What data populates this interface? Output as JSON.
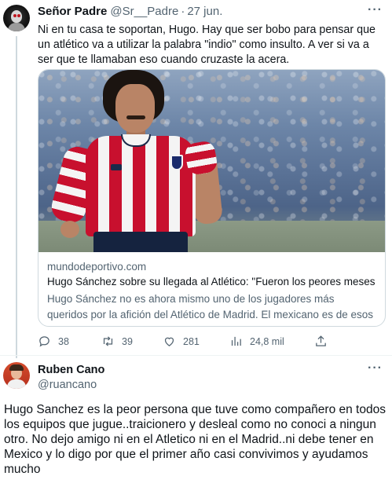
{
  "tweet1": {
    "display_name": "Señor Padre",
    "handle": "@Sr__Padre",
    "separator": "·",
    "date": "27 jun.",
    "text": "Ni en tu casa te soportan, Hugo. Hay que ser bobo para pensar que un atlético va a utilizar la palabra \"indio\" como insulto. A ver si va a ser que te llamaban eso cuando cruzaste la acera.",
    "card": {
      "domain": "mundodeportivo.com",
      "title": "Hugo Sánchez sobre su llegada al Atlético: \"Fueron los peores meses ...",
      "description": "Hugo Sánchez no es ahora mismo uno de los jugadores más queridos por la afición del Atlético de Madrid. El mexicano es de esos futbolist..."
    },
    "actions": {
      "replies": "38",
      "retweets": "39",
      "likes": "281",
      "views": "24,8 mil"
    },
    "more_icon": "···"
  },
  "tweet2": {
    "display_name": "Ruben Cano",
    "handle": "@ruancano",
    "more_icon": "···",
    "text": "Hugo Sanchez es la peor persona que tuve como compañero en todos los equipos que jugue..traicionero y desleal como no conoci a ningun otro. No dejo amigo ni en el Atletico ni en el Madrid..ni debe tener en Mexico y lo digo por que el primer año casi convivimos y ayudamos mucho"
  },
  "icons": {
    "reply": "reply-icon",
    "retweet": "retweet-icon",
    "like": "heart-icon",
    "views": "views-icon",
    "share": "share-icon",
    "more": "more-icon"
  },
  "colors": {
    "text": "#0f1419",
    "secondary": "#536471",
    "border": "#cfd9de",
    "atletico_red": "#c8102e"
  }
}
